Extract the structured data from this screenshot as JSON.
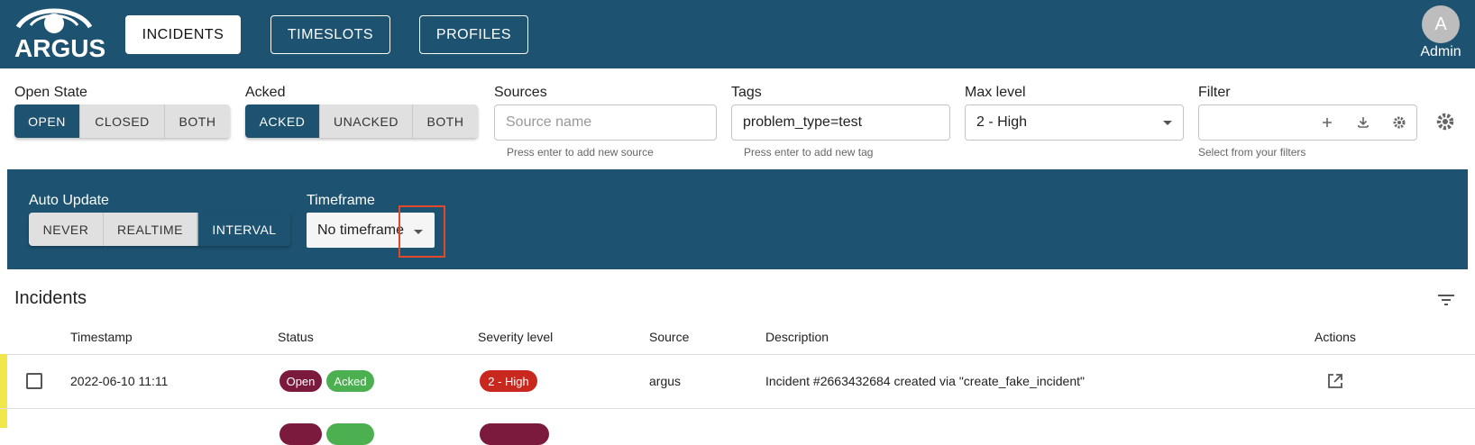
{
  "header": {
    "logo_text": "ARGUS",
    "nav": [
      {
        "label": "INCIDENTS"
      },
      {
        "label": "TIMESLOTS"
      },
      {
        "label": "PROFILES"
      }
    ],
    "avatar_initial": "A",
    "user_label": "Admin"
  },
  "filters": {
    "open_state": {
      "label": "Open State",
      "options": [
        "OPEN",
        "CLOSED",
        "BOTH"
      ],
      "selected": "OPEN"
    },
    "acked": {
      "label": "Acked",
      "options": [
        "ACKED",
        "UNACKED",
        "BOTH"
      ],
      "selected": "ACKED"
    },
    "sources": {
      "label": "Sources",
      "placeholder": "Source name",
      "helper": "Press enter to add new source"
    },
    "tags": {
      "label": "Tags",
      "value": "problem_type=test",
      "helper": "Press enter to add new tag"
    },
    "max_level": {
      "label": "Max level",
      "value": "2 - High"
    },
    "filter": {
      "label": "Filter",
      "value": "",
      "helper": "Select from your filters"
    }
  },
  "auto_update": {
    "label": "Auto Update",
    "options": [
      "NEVER",
      "REALTIME",
      "INTERVAL"
    ],
    "selected": "INTERVAL"
  },
  "timeframe": {
    "label": "Timeframe",
    "value": "No timeframe"
  },
  "incidents": {
    "title": "Incidents",
    "columns": [
      "Timestamp",
      "Status",
      "Severity level",
      "Source",
      "Description",
      "Actions"
    ],
    "rows": [
      {
        "timestamp": "2022-06-10 11:11",
        "status": [
          "Open",
          "Acked"
        ],
        "severity": "2 - High",
        "source": "argus",
        "description": "Incident #2663432684 created via \"create_fake_incident\""
      }
    ]
  },
  "colors": {
    "brand": "#1d5271",
    "open_chip": "#7b1a3c",
    "acked_chip": "#4caf50",
    "severity_high": "#c8281e",
    "row_accent": "#f1e74a",
    "highlight": "#e0492b"
  },
  "icons": [
    "eye-logo-icon",
    "plus-icon",
    "download-icon",
    "gear-icon",
    "settings-icon",
    "filter-list-icon",
    "open-in-new-icon",
    "dropdown-caret-icon"
  ]
}
